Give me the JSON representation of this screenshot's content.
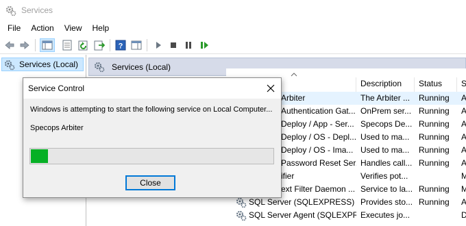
{
  "window": {
    "title": "Services"
  },
  "menu": [
    {
      "label": "File"
    },
    {
      "label": "Action"
    },
    {
      "label": "View"
    },
    {
      "label": "Help"
    }
  ],
  "toolbar": {
    "icons": [
      "back-arrow-icon",
      "forward-arrow-icon",
      "show-hide-tree-icon",
      "properties-icon",
      "refresh-icon",
      "export-list-icon",
      "help-icon",
      "action-pane-icon",
      "start-service-icon",
      "stop-service-icon",
      "pause-service-icon",
      "resume-service-icon"
    ]
  },
  "tree": {
    "root_label": "Services (Local)"
  },
  "pane": {
    "header_label": "Services (Local)"
  },
  "columns": [
    "Description",
    "Status",
    "S"
  ],
  "services": [
    {
      "name": "Arbiter",
      "description": "The Arbiter ...",
      "status": "Running",
      "startup": "A",
      "selected": true
    },
    {
      "name": "Authentication Gat...",
      "description": "OnPrem ser...",
      "status": "Running",
      "startup": "A"
    },
    {
      "name": "Deploy / App - Ser...",
      "description": "Specops De...",
      "status": "Running",
      "startup": "A"
    },
    {
      "name": "Deploy / OS - Depl...",
      "description": "Used to ma...",
      "status": "Running",
      "startup": "A"
    },
    {
      "name": "Deploy / OS - Ima...",
      "description": "Used to ma...",
      "status": "Running",
      "startup": "A"
    },
    {
      "name": "Password Reset Ser...",
      "description": "Handles call...",
      "status": "Running",
      "startup": "A"
    },
    {
      "name": "ifier",
      "description": "Verifies pot...",
      "status": "",
      "startup": "M"
    },
    {
      "name": "ext Filter Daemon ...",
      "description": "Service to la...",
      "status": "Running",
      "startup": "M"
    },
    {
      "name": "SQL Server (SQLEXPRESS)",
      "description": "Provides sto...",
      "status": "Running",
      "startup": "A"
    },
    {
      "name": "SQL Server Agent (SQLEXPR...",
      "description": "Executes jo...",
      "status": "",
      "startup": "D"
    }
  ],
  "dialog": {
    "title": "Service Control",
    "message": "Windows is attempting to start the following service on Local Computer...",
    "service_name": "Specops Arbiter",
    "progress_percent": 7,
    "close_label": "Close"
  },
  "colors": {
    "progress_green": "#06b025",
    "header_blue": "#d6dbe9",
    "selection": "#cce8ff",
    "focus_border": "#0078d7"
  }
}
